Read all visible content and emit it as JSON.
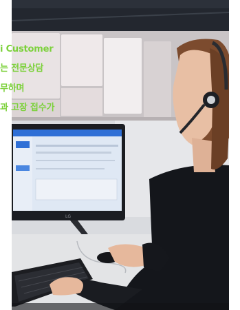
{
  "caption": {
    "lines": [
      "i Customer",
      "는 전문상담",
      "무하며",
      "과 고장 접수가"
    ]
  },
  "monitor": {
    "brand": "LG"
  },
  "colors": {
    "caption_green": "#7cd13b",
    "screen_blue": "#2f6fd6"
  }
}
